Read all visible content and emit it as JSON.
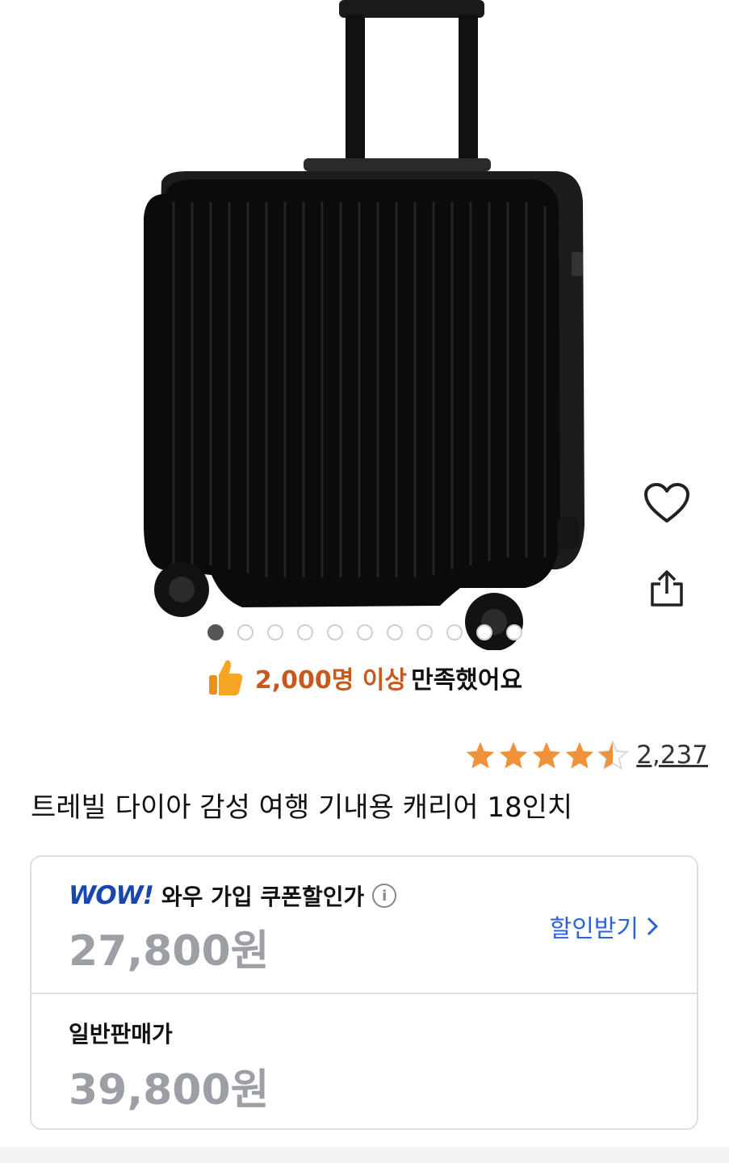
{
  "product": {
    "image_alt": "suitcase-product-photo",
    "carousel": {
      "total": 11,
      "active": 0
    }
  },
  "banner": {
    "highlight": "2,000명 이상",
    "rest": "만족했어요"
  },
  "rating": {
    "stars": 4.5,
    "count": "2,237"
  },
  "title": "트레빌 다이아 감성 여행 기내용 캐리어 18인치",
  "price": {
    "wow_logo": "WOW!",
    "wow_label": "와우 가입 쿠폰할인가",
    "wow_price": "27,800원",
    "discount_button": "할인받기",
    "normal_label": "일반판매가",
    "normal_price": "39,800원"
  },
  "colors": {
    "accent_orange": "#c8591c",
    "star": "#f0923a",
    "wow_blue": "#1a47ae",
    "link_blue": "#2b64d6",
    "price_gray": "#9ca0a6"
  }
}
